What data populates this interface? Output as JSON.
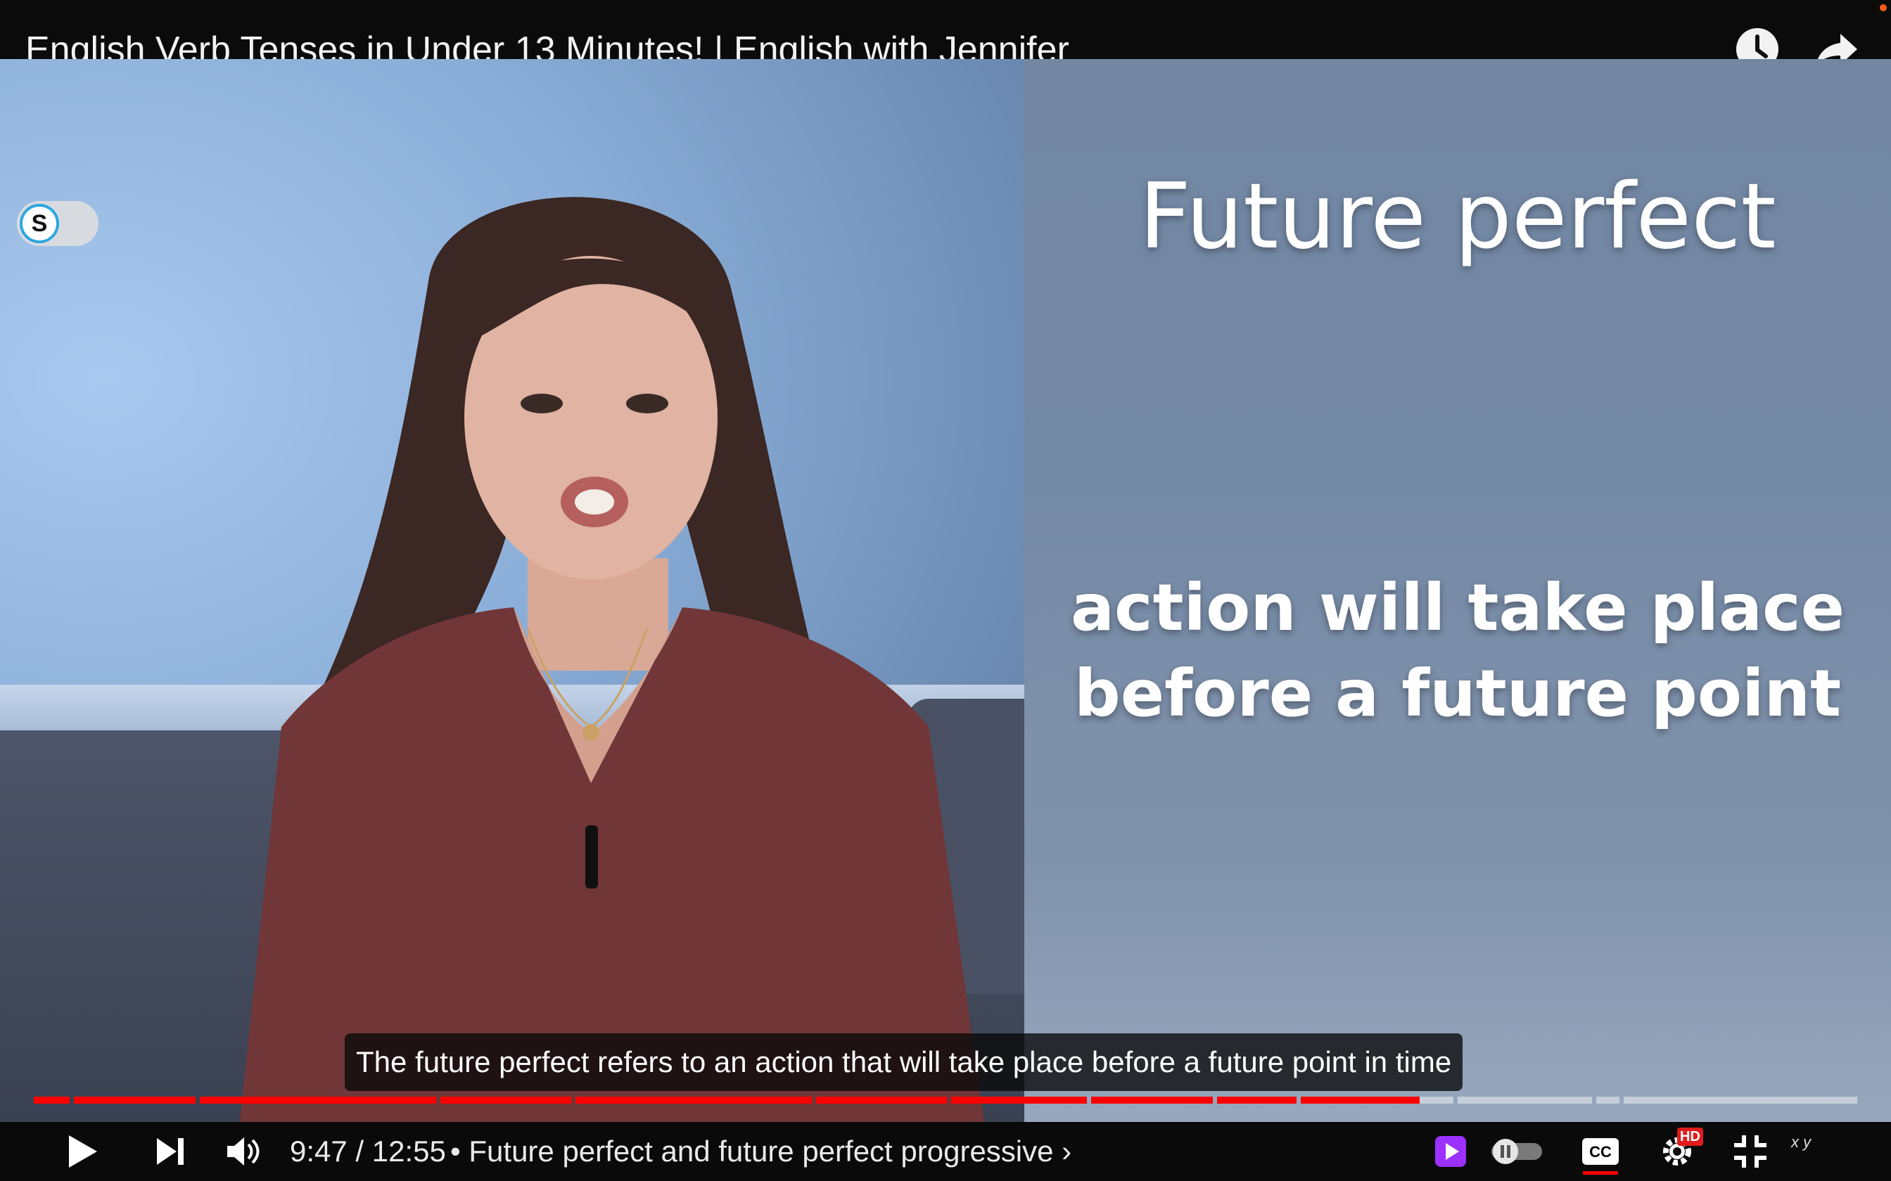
{
  "window": {
    "title": "English Verb Tenses in Under 13 Minutes! | English with Jennifer",
    "watch_later_icon": "clock-icon",
    "share_icon": "share-arrow-icon"
  },
  "video": {
    "overlay_title": "Future perfect",
    "overlay_definition_line1": "action will take place",
    "overlay_definition_line2": "before a future point",
    "extension_toggle_letter": "S",
    "caption": "The future perfect refers to an action that will take place before a future point in time"
  },
  "player": {
    "played_fraction": 0.762,
    "segments": [
      {
        "end_fraction": 0.022
      },
      {
        "end_fraction": 0.091
      },
      {
        "end_fraction": 0.223
      },
      {
        "end_fraction": 0.297
      },
      {
        "end_fraction": 0.429
      },
      {
        "end_fraction": 0.503
      },
      {
        "end_fraction": 0.58
      },
      {
        "end_fraction": 0.649
      },
      {
        "end_fraction": 0.695
      },
      {
        "end_fraction": 0.781
      },
      {
        "end_fraction": 0.857
      },
      {
        "end_fraction": 0.872
      },
      {
        "end_fraction": 1.0
      }
    ],
    "current_time": "9:47",
    "time_separator": "/",
    "duration": "12:55",
    "chapter_separator": "•",
    "chapter_title": "Future perfect and future perfect progressive",
    "chapter_chevron": "›",
    "hd_badge": "HD",
    "cc_label": "CC",
    "xy_label": "x y",
    "accent_color": "#ff0000",
    "icons": {
      "play": "play-icon",
      "next": "next-icon",
      "volume": "volume-icon",
      "extension": "purple-play-extension-icon",
      "autoplay": "autoplay-toggle-icon",
      "captions": "captions-icon",
      "settings": "gear-icon",
      "exit_fullscreen": "exit-fullscreen-icon"
    }
  }
}
